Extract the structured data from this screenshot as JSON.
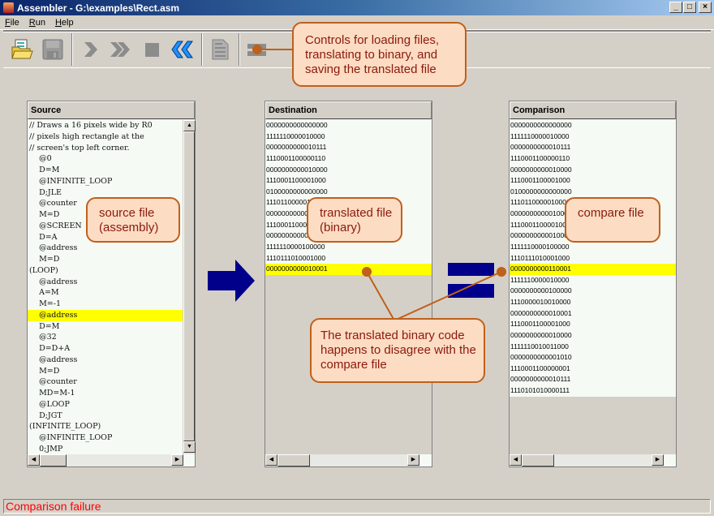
{
  "window": {
    "title": "Assembler - G:\\examples\\Rect.asm",
    "controls": [
      "_",
      "□",
      "×"
    ]
  },
  "menu": [
    "File",
    "Run",
    "Help"
  ],
  "toolbar": {
    "buttons": [
      {
        "name": "load-file",
        "icon": "open-folder-icon"
      },
      {
        "name": "save-file",
        "icon": "floppy-disk-icon",
        "disabled": true
      },
      {
        "name": "single-step",
        "icon": "chevron-right-icon",
        "disabled": true
      },
      {
        "name": "fast-forward",
        "icon": "double-chevron-right-icon",
        "disabled": true
      },
      {
        "name": "stop",
        "icon": "stop-square-icon",
        "disabled": true
      },
      {
        "name": "rewind",
        "icon": "double-chevron-left-icon"
      },
      {
        "name": "full-translation",
        "icon": "binary-document-icon",
        "disabled": true
      },
      {
        "name": "comparison",
        "icon": "equals-icon"
      }
    ]
  },
  "source": {
    "header": "Source",
    "highlight_index": 17,
    "lines": [
      "// Draws a 16 pixels wide by R0",
      "// pixels high rectangle at the",
      "// screen's top left corner.",
      "    @0",
      "    D=M",
      "    @INFINITE_LOOP",
      "    D;JLE",
      "    @counter",
      "    M=D",
      "    @SCREEN",
      "    D=A",
      "    @address",
      "    M=D",
      "(LOOP)",
      "    @address",
      "    A=M",
      "    M=-1",
      "    @address",
      "    D=M",
      "    @32",
      "    D=D+A",
      "    @address",
      "    M=D",
      "    @counter",
      "    MD=M-1",
      "    @LOOP",
      "    D;JGT",
      "(INFINITE_LOOP)",
      "    @INFINITE_LOOP",
      "    0;JMP"
    ]
  },
  "destination": {
    "header": "Destination",
    "highlight_index": 13,
    "lines": [
      "0000000000000000",
      "1111110000010000",
      "0000000000010111",
      "1110001100000110",
      "0000000000010000",
      "1110001100001000",
      "0100000000000000",
      "1110110000010000",
      "0000000000010001",
      "1110001100001000",
      "0000000000010001",
      "1111110000100000",
      "1110111010001000",
      "0000000000010001"
    ]
  },
  "comparison": {
    "header": "Comparison",
    "highlight_index": 13,
    "lines": [
      "0000000000000000",
      "1111110000010000",
      "0000000000010111",
      "1110001100000110",
      "0000000000010000",
      "1110001100001000",
      "0100000000000000",
      "1110110000010000",
      "0000000000010001",
      "1110001100001000",
      "0000000000010001",
      "1111110000100000",
      "1110111010001000",
      "0000000000110001",
      "1111110000010000",
      "0000000000100000",
      "1110000010010000",
      "0000000000010001",
      "1110001100001000",
      "0000000000010000",
      "1111110010011000",
      "0000000000001010",
      "1110001100000001",
      "0000000000010111",
      "1110101010000111"
    ]
  },
  "callouts": {
    "controls": "Controls for loading files, translating to binary, and saving the translated file",
    "source": "source file (assembly)",
    "translated": "translated file (binary)",
    "compare": "compare file",
    "disagree": "The translated binary code happens to disagree with the compare file"
  },
  "status": "Comparison failure",
  "colors": {
    "highlight": "#ffff00",
    "callout_fill": "#fddcc4",
    "callout_border": "#c0601a",
    "callout_text": "#8b1a0a",
    "arrow": "#00008b",
    "status_text": "#ff0000"
  }
}
